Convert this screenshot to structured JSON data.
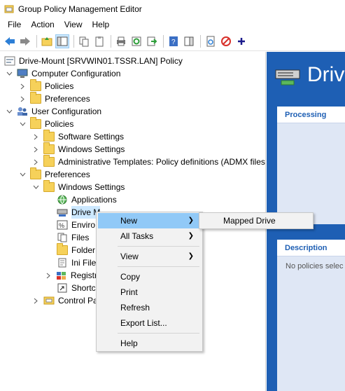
{
  "window": {
    "title": "Group Policy Management Editor"
  },
  "menubar": [
    "File",
    "Action",
    "View",
    "Help"
  ],
  "tree": {
    "root": "Drive-Mount [SRVWIN01.TSSR.LAN] Policy",
    "computer_configuration": "Computer Configuration",
    "cc_policies": "Policies",
    "cc_preferences": "Preferences",
    "user_configuration": "User Configuration",
    "uc_policies": "Policies",
    "software_settings": "Software Settings",
    "windows_settings_policies": "Windows Settings",
    "admin_templates": "Administrative Templates: Policy definitions (ADMX files",
    "uc_preferences": "Preferences",
    "windows_settings_prefs": "Windows Settings",
    "applications": "Applications",
    "drive_maps": "Drive M",
    "environment": "Enviro",
    "files": "Files",
    "folders": "Folder",
    "ini_files": "Ini File",
    "registry": "Registr",
    "shortcuts": "Shortc",
    "control_panel": "Control Pa"
  },
  "right_pane": {
    "title": "Drive",
    "processing_header": "Processing",
    "description_header": "Description",
    "description_text": "No policies selec"
  },
  "context_menu": {
    "new": "New",
    "all_tasks": "All Tasks",
    "view": "View",
    "copy": "Copy",
    "print": "Print",
    "refresh": "Refresh",
    "export_list": "Export List...",
    "help": "Help"
  },
  "submenu": {
    "mapped_drive": "Mapped Drive"
  },
  "colors": {
    "accent": "#1e5fb4",
    "highlight": "#91c9f7",
    "selection": "#cce8ff"
  }
}
